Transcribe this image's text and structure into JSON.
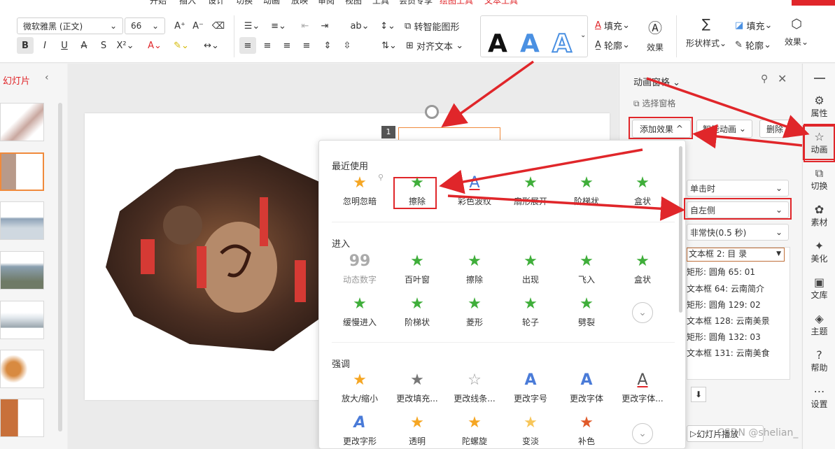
{
  "tab_strip": {
    "tabs": [
      "开始",
      "插入",
      "设计",
      "切换",
      "动画",
      "放映",
      "审阅",
      "视图",
      "工具",
      "会员专享",
      "绘图工具",
      "文本工具"
    ]
  },
  "ribbon": {
    "font_name": "微软雅黑 (正文)",
    "font_size": "66",
    "smart_graphic": "转智能图形",
    "align_text": "对齐文本",
    "fill": "填充",
    "outline": "轮廓",
    "effect": "效果",
    "shape_style": "形状样式",
    "fill2": "填充",
    "outline2": "轮廓",
    "effect2": "效果",
    "text_style_letter": "A"
  },
  "left_panel": {
    "title": "幻灯片"
  },
  "anim_pane": {
    "title": "动画窗格",
    "select_pane": "选择窗格",
    "add_effect": "添加效果",
    "smart_anim": "智能动画",
    "delete": "删除",
    "start": "单击时",
    "direction": "自左侧",
    "speed": "非常快(0.5 秒)",
    "items": [
      "文本框 2: 目  录",
      "矩形: 圆角 65: 01",
      "文本框 64: 云南简介",
      "矩形: 圆角 129: 02",
      "文本框 128: 云南美景",
      "矩形: 圆角 132: 03",
      "文本框 131: 云南美食"
    ],
    "play_button": "幻灯片播放",
    "watermark": "CSDN @shelian_"
  },
  "right_bar": {
    "items": [
      {
        "label": "属性",
        "icon": "properties-icon"
      },
      {
        "label": "动画",
        "icon": "star-icon"
      },
      {
        "label": "切换",
        "icon": "transition-icon"
      },
      {
        "label": "素材",
        "icon": "material-icon"
      },
      {
        "label": "美化",
        "icon": "beautify-icon"
      },
      {
        "label": "文库",
        "icon": "library-icon"
      },
      {
        "label": "主题",
        "icon": "theme-icon"
      },
      {
        "label": "帮助",
        "icon": "help-icon"
      },
      {
        "label": "设置",
        "icon": "settings-icon"
      }
    ]
  },
  "slide": {
    "number_badge": "1"
  },
  "popup": {
    "recent_title": "最近使用",
    "recent": [
      "忽明忽暗",
      "擦除",
      "彩色波纹",
      "扇形展开",
      "阶梯状",
      "盒状"
    ],
    "enter_title": "进入",
    "enter_row1": [
      "动态数字",
      "百叶窗",
      "擦除",
      "出现",
      "飞入",
      "盒状"
    ],
    "enter_row2": [
      "缓慢进入",
      "阶梯状",
      "菱形",
      "轮子",
      "劈裂"
    ],
    "emphasis_title": "强调",
    "emphasis_row1": [
      "放大/缩小",
      "更改填充...",
      "更改线条...",
      "更改字号",
      "更改字体",
      "更改字体..."
    ],
    "emphasis_row2": [
      "更改字形",
      "透明",
      "陀螺旋",
      "变淡",
      "补色"
    ]
  },
  "colors": {
    "accent_red": "#e0262a",
    "star_green": "#3fae3a",
    "star_gold": "#f5a623",
    "highlight_blue": "#4a90e2"
  }
}
